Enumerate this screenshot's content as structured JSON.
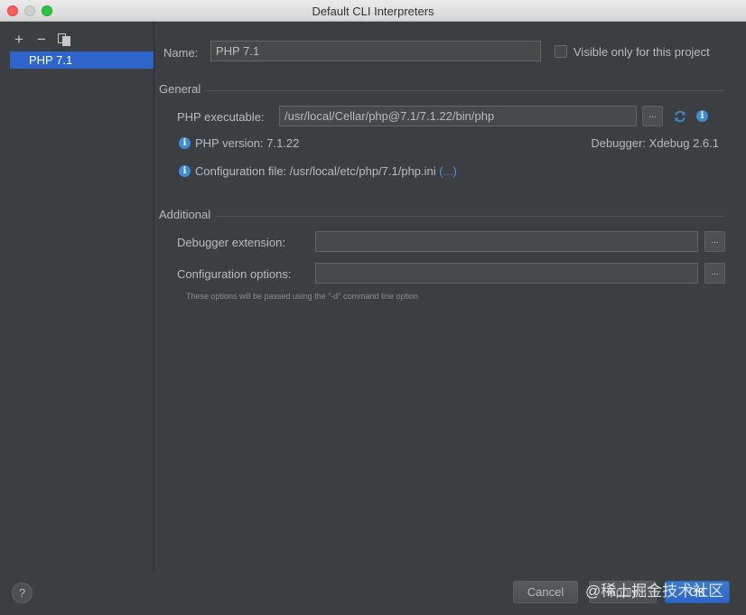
{
  "window": {
    "title": "Default CLI Interpreters"
  },
  "sidebar": {
    "toolbar": {
      "add": "+",
      "remove": "−",
      "copy_icon": "copy-icon"
    },
    "items": [
      {
        "label": "PHP 7.1",
        "selected": true
      }
    ]
  },
  "form": {
    "name_label": "Name:",
    "name_value": "PHP 7.1",
    "visible_label": "Visible only for this project",
    "visible_checked": false
  },
  "general": {
    "title": "General",
    "executable_label": "PHP executable:",
    "executable_value": "/usr/local/Cellar/php@7.1/7.1.22/bin/php",
    "browse": "...",
    "version_text": "PHP version: 7.1.22",
    "debugger_text": "Debugger: Xdebug 2.6.1",
    "config_file_text": "Configuration file: /usr/local/etc/php/7.1/php.ini",
    "config_file_link": "(...)"
  },
  "additional": {
    "title": "Additional",
    "debugger_ext_label": "Debugger extension:",
    "debugger_ext_value": "",
    "config_options_label": "Configuration options:",
    "config_options_value": "",
    "browse": "...",
    "hint": "These options will be passed using the \"-d\" command line option"
  },
  "footer": {
    "help": "?",
    "cancel": "Cancel",
    "apply": "Apply",
    "ok": "OK",
    "watermark": "@稀土掘金技术社区"
  },
  "colors": {
    "accent": "#2f65ca",
    "info": "#3f8bd6",
    "background": "#3c3f41"
  }
}
